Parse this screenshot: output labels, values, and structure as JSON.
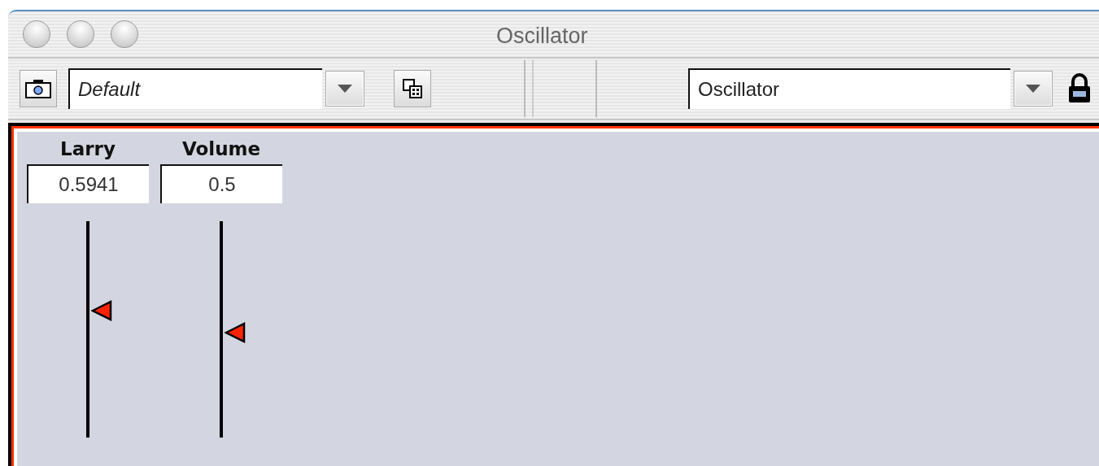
{
  "window": {
    "title": "Oscillator"
  },
  "toolbar": {
    "preset": {
      "value": "Default"
    },
    "patch": {
      "value": "Oscillator"
    }
  },
  "controls": [
    {
      "label": "Larry",
      "value": "0.5941",
      "level": 0.59
    },
    {
      "label": "Volume",
      "value": "0.5",
      "level": 0.49
    }
  ]
}
